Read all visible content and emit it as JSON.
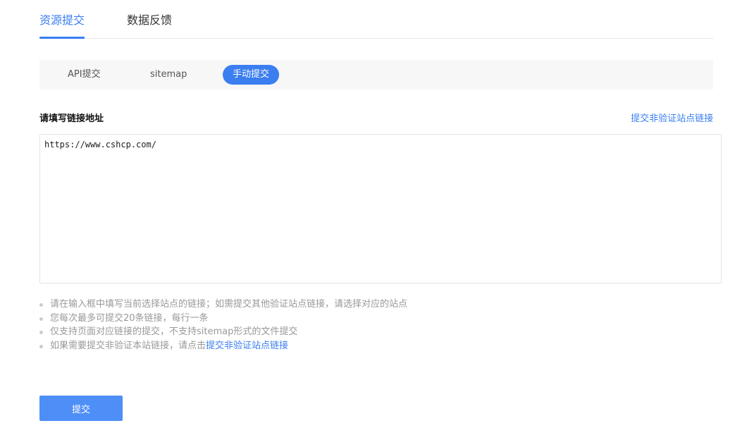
{
  "top_tabs": {
    "items": [
      {
        "label": "资源提交",
        "active": true
      },
      {
        "label": "数据反馈",
        "active": false
      }
    ]
  },
  "sub_tabs": {
    "items": [
      {
        "label": "API提交",
        "active": false
      },
      {
        "label": "sitemap",
        "active": false
      },
      {
        "label": "手动提交",
        "active": true
      }
    ]
  },
  "form": {
    "label": "请填写链接地址",
    "nonverified_link": "提交非验证站点链接",
    "textarea_value": "https://www.cshcp.com/"
  },
  "tips": {
    "items": [
      "请在输入框中填写当前选择站点的链接；如需提交其他验证站点链接，请选择对应的站点",
      "您每次最多可提交20条链接，每行一条",
      "仅支持页面对应链接的提交，不支持sitemap形式的文件提交"
    ],
    "last_prefix": "如果需要提交非验证本站链接，请点击",
    "last_link": "提交非验证站点链接"
  },
  "submit": {
    "label": "提交"
  },
  "colors": {
    "accent": "#3a7ef0",
    "button": "#4e8ef7",
    "tip_text": "#999999",
    "tab_bar_bg": "#f7f7f7"
  }
}
